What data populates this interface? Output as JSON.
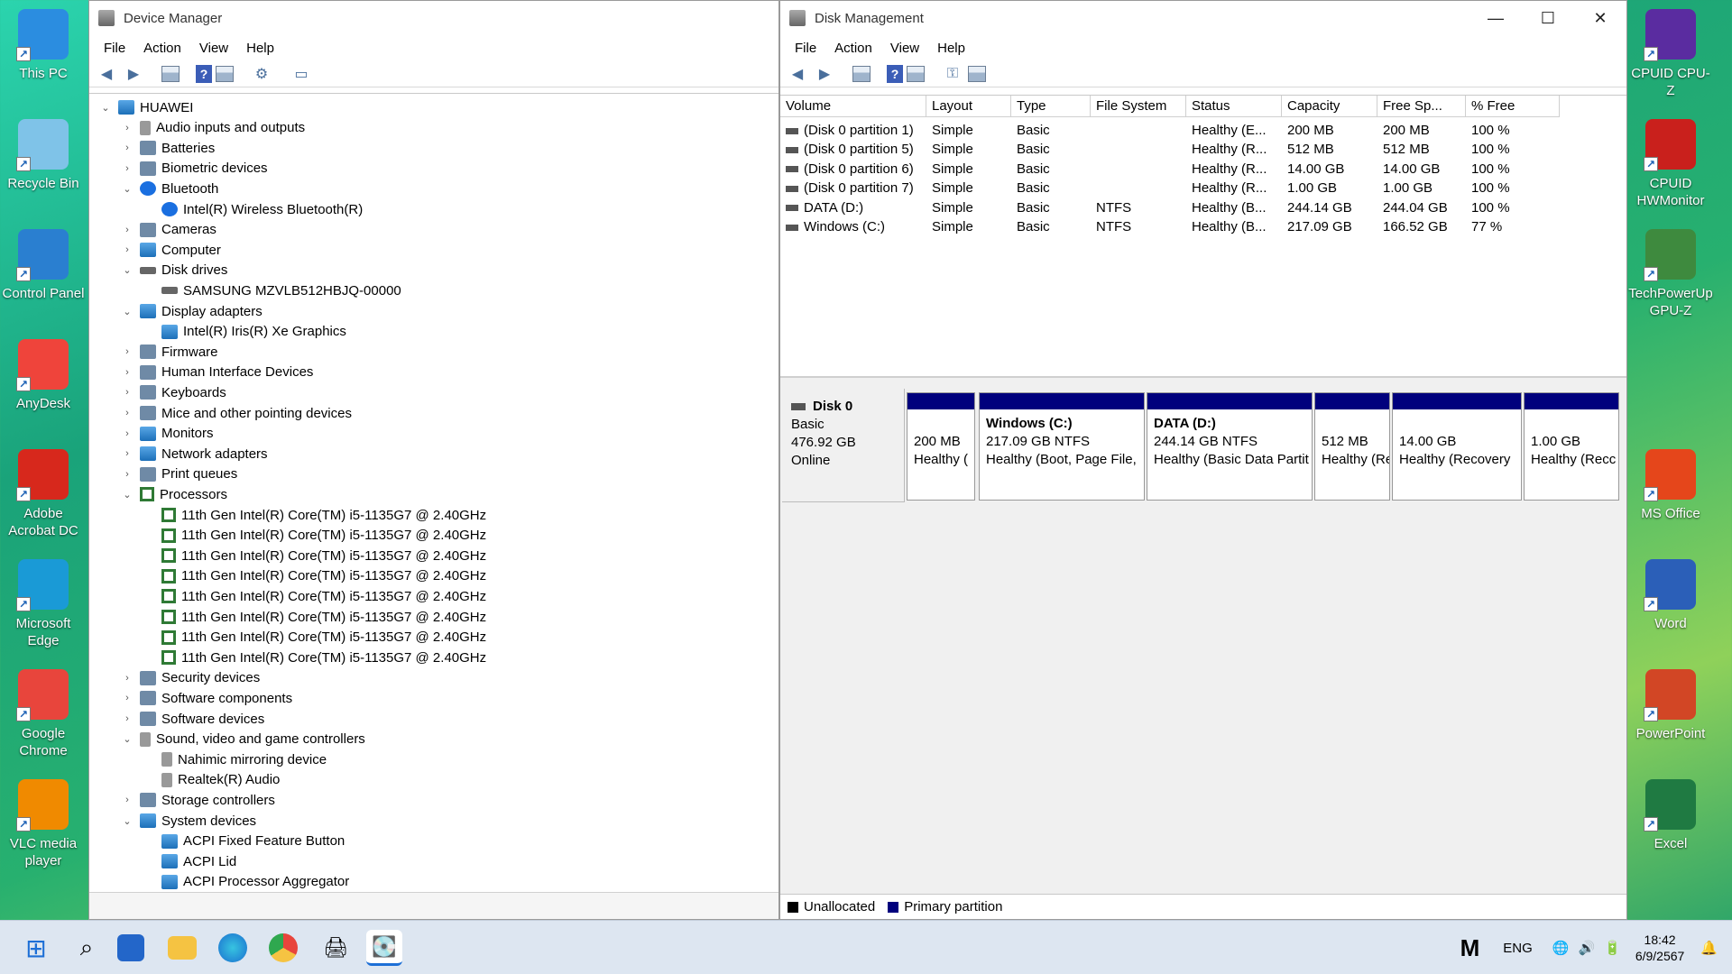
{
  "desktop_left": [
    {
      "label": "This PC",
      "icon": "monitor-icon",
      "color": "#2b8de0"
    },
    {
      "label": "Recycle Bin",
      "icon": "recycle-bin-icon",
      "color": "#7fc3e8"
    },
    {
      "label": "Control Panel",
      "icon": "control-panel-icon",
      "color": "#2a7fd0"
    },
    {
      "label": "AnyDesk",
      "icon": "anydesk-icon",
      "color": "#ef443b"
    },
    {
      "label": "Adobe Acrobat DC",
      "icon": "acrobat-icon",
      "color": "#d7281c"
    },
    {
      "label": "Microsoft Edge",
      "icon": "edge-icon",
      "color": "#1a9ad6"
    },
    {
      "label": "Google Chrome",
      "icon": "chrome-icon",
      "color": "#e8453c"
    },
    {
      "label": "VLC media player",
      "icon": "vlc-icon",
      "color": "#f08a00"
    }
  ],
  "desktop_right": [
    {
      "label": "CPUID CPU-Z",
      "icon": "cpuz-icon",
      "color": "#5a2ca0"
    },
    {
      "label": "CPUID HWMonitor",
      "icon": "hwmonitor-icon",
      "color": "#c9201c"
    },
    {
      "label": "TechPowerUp GPU-Z",
      "icon": "gpuz-icon",
      "color": "#3e8a3e"
    },
    {
      "label": "MS Office",
      "icon": "office-icon",
      "color": "#e5461b"
    },
    {
      "label": "Word",
      "icon": "word-icon",
      "color": "#2b5fb8"
    },
    {
      "label": "PowerPoint",
      "icon": "powerpoint-icon",
      "color": "#d24625"
    },
    {
      "label": "Excel",
      "icon": "excel-icon",
      "color": "#1f7a42"
    }
  ],
  "device_manager": {
    "title": "Device Manager",
    "menu": [
      "File",
      "Action",
      "View",
      "Help"
    ],
    "tree": [
      {
        "label": "HUAWEI",
        "level": 0,
        "chev": "⌄",
        "icon": "computer"
      },
      {
        "label": "Audio inputs and outputs",
        "level": 1,
        "chev": "›",
        "icon": "snd"
      },
      {
        "label": "Batteries",
        "level": 1,
        "chev": "›",
        "icon": "gen"
      },
      {
        "label": "Biometric devices",
        "level": 1,
        "chev": "›",
        "icon": "gen"
      },
      {
        "label": "Bluetooth",
        "level": 1,
        "chev": "⌄",
        "icon": "bt"
      },
      {
        "label": "Intel(R) Wireless Bluetooth(R)",
        "level": 2,
        "chev": "",
        "icon": "bt"
      },
      {
        "label": "Cameras",
        "level": 1,
        "chev": "›",
        "icon": "gen"
      },
      {
        "label": "Computer",
        "level": 1,
        "chev": "›",
        "icon": "mon"
      },
      {
        "label": "Disk drives",
        "level": 1,
        "chev": "⌄",
        "icon": "disk"
      },
      {
        "label": "SAMSUNG MZVLB512HBJQ-00000",
        "level": 2,
        "chev": "",
        "icon": "disk"
      },
      {
        "label": "Display adapters",
        "level": 1,
        "chev": "⌄",
        "icon": "mon"
      },
      {
        "label": "Intel(R) Iris(R) Xe Graphics",
        "level": 2,
        "chev": "",
        "icon": "mon"
      },
      {
        "label": "Firmware",
        "level": 1,
        "chev": "›",
        "icon": "gen"
      },
      {
        "label": "Human Interface Devices",
        "level": 1,
        "chev": "›",
        "icon": "gen"
      },
      {
        "label": "Keyboards",
        "level": 1,
        "chev": "›",
        "icon": "gen"
      },
      {
        "label": "Mice and other pointing devices",
        "level": 1,
        "chev": "›",
        "icon": "gen"
      },
      {
        "label": "Monitors",
        "level": 1,
        "chev": "›",
        "icon": "mon"
      },
      {
        "label": "Network adapters",
        "level": 1,
        "chev": "›",
        "icon": "mon"
      },
      {
        "label": "Print queues",
        "level": 1,
        "chev": "›",
        "icon": "gen"
      },
      {
        "label": "Processors",
        "level": 1,
        "chev": "⌄",
        "icon": "cpu"
      },
      {
        "label": "11th Gen Intel(R) Core(TM) i5-1135G7 @ 2.40GHz",
        "level": 2,
        "chev": "",
        "icon": "cpu"
      },
      {
        "label": "11th Gen Intel(R) Core(TM) i5-1135G7 @ 2.40GHz",
        "level": 2,
        "chev": "",
        "icon": "cpu"
      },
      {
        "label": "11th Gen Intel(R) Core(TM) i5-1135G7 @ 2.40GHz",
        "level": 2,
        "chev": "",
        "icon": "cpu"
      },
      {
        "label": "11th Gen Intel(R) Core(TM) i5-1135G7 @ 2.40GHz",
        "level": 2,
        "chev": "",
        "icon": "cpu"
      },
      {
        "label": "11th Gen Intel(R) Core(TM) i5-1135G7 @ 2.40GHz",
        "level": 2,
        "chev": "",
        "icon": "cpu"
      },
      {
        "label": "11th Gen Intel(R) Core(TM) i5-1135G7 @ 2.40GHz",
        "level": 2,
        "chev": "",
        "icon": "cpu"
      },
      {
        "label": "11th Gen Intel(R) Core(TM) i5-1135G7 @ 2.40GHz",
        "level": 2,
        "chev": "",
        "icon": "cpu"
      },
      {
        "label": "11th Gen Intel(R) Core(TM) i5-1135G7 @ 2.40GHz",
        "level": 2,
        "chev": "",
        "icon": "cpu"
      },
      {
        "label": "Security devices",
        "level": 1,
        "chev": "›",
        "icon": "gen"
      },
      {
        "label": "Software components",
        "level": 1,
        "chev": "›",
        "icon": "gen"
      },
      {
        "label": "Software devices",
        "level": 1,
        "chev": "›",
        "icon": "gen"
      },
      {
        "label": "Sound, video and game controllers",
        "level": 1,
        "chev": "⌄",
        "icon": "snd"
      },
      {
        "label": "Nahimic mirroring device",
        "level": 2,
        "chev": "",
        "icon": "snd"
      },
      {
        "label": "Realtek(R) Audio",
        "level": 2,
        "chev": "",
        "icon": "snd"
      },
      {
        "label": "Storage controllers",
        "level": 1,
        "chev": "›",
        "icon": "gen"
      },
      {
        "label": "System devices",
        "level": 1,
        "chev": "⌄",
        "icon": "mon"
      },
      {
        "label": "ACPI Fixed Feature Button",
        "level": 2,
        "chev": "",
        "icon": "mon"
      },
      {
        "label": "ACPI Lid",
        "level": 2,
        "chev": "",
        "icon": "mon"
      },
      {
        "label": "ACPI Processor Aggregator",
        "level": 2,
        "chev": "",
        "icon": "mon"
      }
    ]
  },
  "disk_management": {
    "title": "Disk Management",
    "menu": [
      "File",
      "Action",
      "View",
      "Help"
    ],
    "columns": [
      "Volume",
      "Layout",
      "Type",
      "File System",
      "Status",
      "Capacity",
      "Free Sp...",
      "% Free"
    ],
    "rows": [
      [
        "(Disk 0 partition 1)",
        "Simple",
        "Basic",
        "",
        "Healthy (E...",
        "200 MB",
        "200 MB",
        "100 %"
      ],
      [
        "(Disk 0 partition 5)",
        "Simple",
        "Basic",
        "",
        "Healthy (R...",
        "512 MB",
        "512 MB",
        "100 %"
      ],
      [
        "(Disk 0 partition 6)",
        "Simple",
        "Basic",
        "",
        "Healthy (R...",
        "14.00 GB",
        "14.00 GB",
        "100 %"
      ],
      [
        "(Disk 0 partition 7)",
        "Simple",
        "Basic",
        "",
        "Healthy (R...",
        "1.00 GB",
        "1.00 GB",
        "100 %"
      ],
      [
        "DATA (D:)",
        "Simple",
        "Basic",
        "NTFS",
        "Healthy (B...",
        "244.14 GB",
        "244.04 GB",
        "100 %"
      ],
      [
        "Windows (C:)",
        "Simple",
        "Basic",
        "NTFS",
        "Healthy (B...",
        "217.09 GB",
        "166.52 GB",
        "77 %"
      ]
    ],
    "disk": {
      "name": "Disk 0",
      "type": "Basic",
      "size": "476.92 GB",
      "status": "Online"
    },
    "partitions": [
      {
        "title": "",
        "line1": "200 MB",
        "line2": "Healthy ("
      },
      {
        "title": "Windows  (C:)",
        "line1": "217.09 GB NTFS",
        "line2": "Healthy (Boot, Page File,"
      },
      {
        "title": "DATA  (D:)",
        "line1": "244.14 GB NTFS",
        "line2": "Healthy (Basic Data Partit"
      },
      {
        "title": "",
        "line1": "512 MB",
        "line2": "Healthy (Re"
      },
      {
        "title": "",
        "line1": "14.00 GB",
        "line2": "Healthy (Recovery"
      },
      {
        "title": "",
        "line1": "1.00 GB",
        "line2": "Healthy (Recc"
      }
    ],
    "legend": [
      {
        "label": "Unallocated",
        "color": "#000000"
      },
      {
        "label": "Primary partition",
        "color": "#00007d"
      }
    ]
  },
  "taskbar": {
    "lang": "ENG",
    "time": "18:42",
    "date": "6/9/2567"
  }
}
